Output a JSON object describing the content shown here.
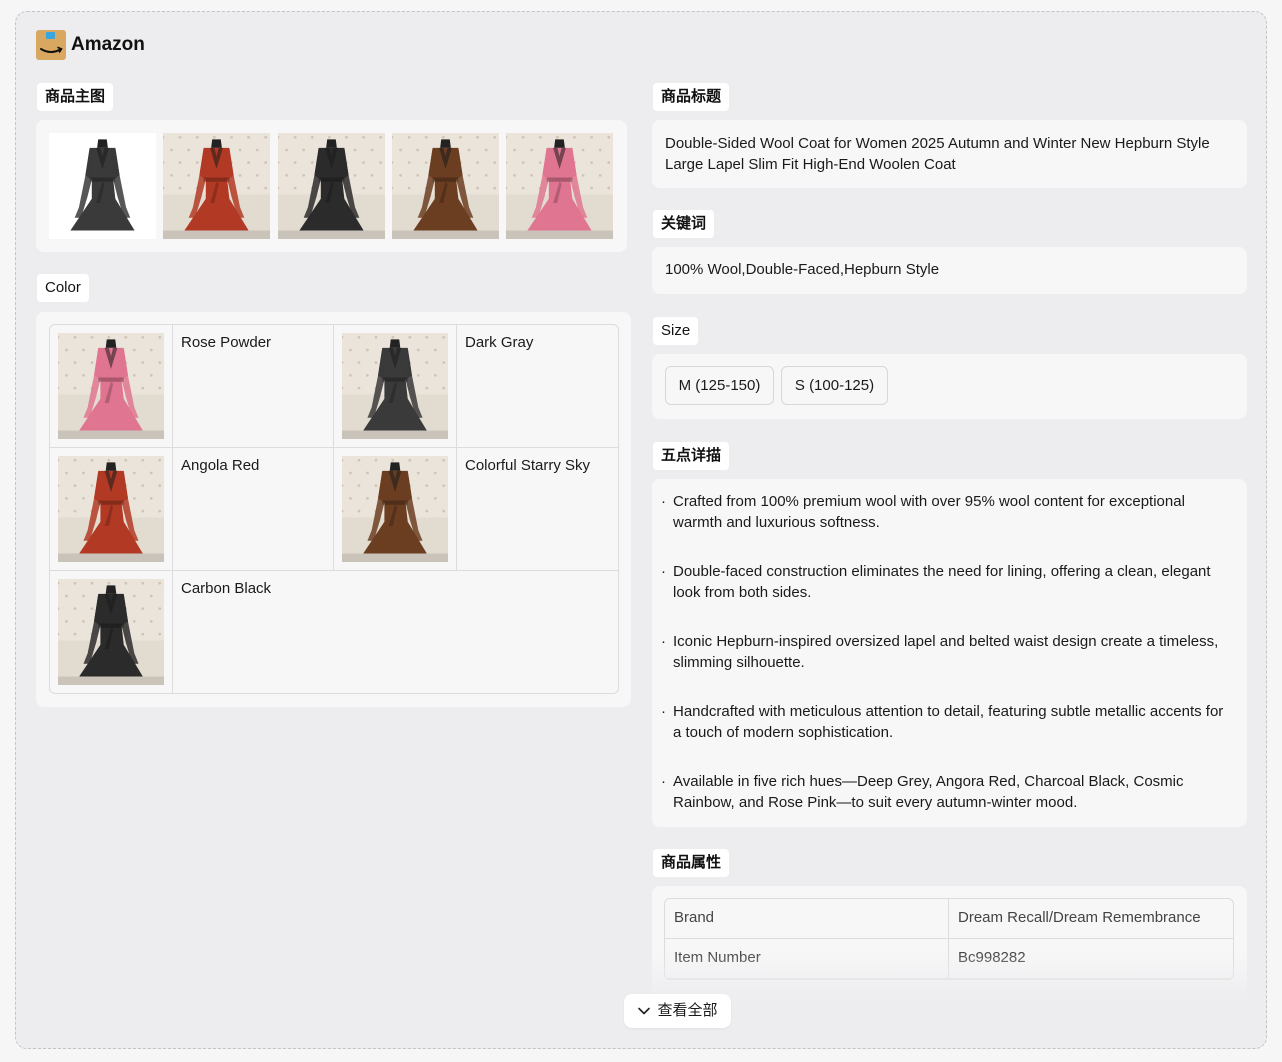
{
  "brand": {
    "name": "Amazon",
    "logo_icon": "amazon-box-icon"
  },
  "sections": {
    "main_images": "商品主图",
    "color": "Color",
    "title": "商品标题",
    "keywords": "关键词",
    "size": "Size",
    "bullets": "五点详描",
    "attributes": "商品属性"
  },
  "main_images": [
    {
      "color": "#3a3a3a",
      "bg": "white"
    },
    {
      "color": "#b23a24",
      "bg": "tufted"
    },
    {
      "color": "#2b2b2b",
      "bg": "tufted"
    },
    {
      "color": "#6b3e22",
      "bg": "tufted"
    },
    {
      "color": "#e07591",
      "bg": "tufted"
    }
  ],
  "colors": [
    {
      "name": "Rose Powder",
      "swatch": "#e07591"
    },
    {
      "name": "Dark Gray",
      "swatch": "#3a3a3a"
    },
    {
      "name": "Angola Red",
      "swatch": "#b23a24"
    },
    {
      "name": "Colorful Starry Sky",
      "swatch": "#6b3e22"
    },
    {
      "name": "Carbon Black",
      "swatch": "#2b2b2b"
    }
  ],
  "product_title": "Double-Sided Wool Coat for Women 2025 Autumn and Winter New Hepburn Style Large Lapel Slim Fit High-End Woolen Coat",
  "keywords": "100% Wool,Double-Faced,Hepburn Style",
  "sizes": [
    "M (125-150)",
    "S (100-125)"
  ],
  "bullets": [
    "Crafted from 100% premium wool with over 95% wool content for exceptional warmth and luxurious softness.",
    "Double-faced construction eliminates the need for lining, offering a clean, elegant look from both sides.",
    "Iconic Hepburn-inspired oversized lapel and belted waist design create a timeless, slimming silhouette.",
    "Handcrafted with meticulous attention to detail, featuring subtle metallic accents for a touch of modern sophistication.",
    "Available in five rich hues—Deep Grey, Angora Red, Charcoal Black, Cosmic Rainbow, and Rose Pink—to suit every autumn-winter mood."
  ],
  "attributes": [
    {
      "key": "Brand",
      "value": "Dream Recall/Dream Remembrance"
    },
    {
      "key": "Item Number",
      "value": "Bc998282"
    }
  ],
  "expand": {
    "label": "查看全部",
    "icon": "chevron-down-icon"
  }
}
